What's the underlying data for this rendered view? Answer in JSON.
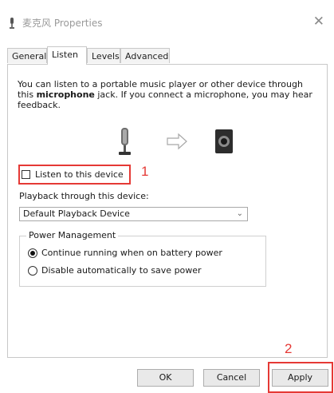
{
  "window": {
    "title": "麦克风 Properties",
    "close_icon": "close-icon"
  },
  "tabs": [
    {
      "label": "General"
    },
    {
      "label": "Listen",
      "active": true
    },
    {
      "label": "Levels"
    },
    {
      "label": "Advanced"
    }
  ],
  "listen": {
    "intro_before": "You can listen to a portable music player or other device through this ",
    "intro_bold": "microphone",
    "intro_after": " jack.  If you connect a microphone, you may hear feedback.",
    "checkbox_label": "Listen to this device",
    "checkbox_checked": false,
    "playback_label": "Playback through this device:",
    "playback_value": "Default Playback Device"
  },
  "power": {
    "title": "Power Management",
    "options": [
      {
        "label": "Continue running when on battery power",
        "selected": true
      },
      {
        "label": "Disable automatically to save power",
        "selected": false
      }
    ]
  },
  "annotations": {
    "step1": "1",
    "step2": "2",
    "color": "#e53935"
  },
  "buttons": {
    "ok": "OK",
    "cancel": "Cancel",
    "apply": "Apply"
  }
}
